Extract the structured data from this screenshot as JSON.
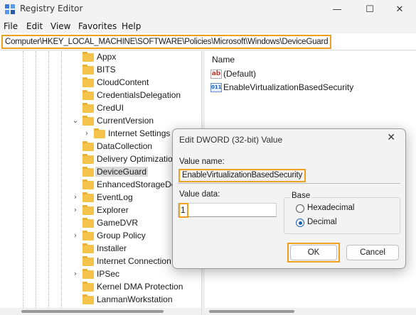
{
  "window": {
    "title": "Registry Editor",
    "min": "—",
    "max": "☐",
    "close": "✕"
  },
  "menu": [
    "File",
    "Edit",
    "View",
    "Favorites",
    "Help"
  ],
  "address": "Computer\\HKEY_LOCAL_MACHINE\\SOFTWARE\\Policies\\Microsoft\\Windows\\DeviceGuard",
  "tree": [
    {
      "label": "Appx",
      "expander": ""
    },
    {
      "label": "BITS",
      "expander": ""
    },
    {
      "label": "CloudContent",
      "expander": ""
    },
    {
      "label": "CredentialsDelegation",
      "expander": ""
    },
    {
      "label": "CredUI",
      "expander": ""
    },
    {
      "label": "CurrentVersion",
      "expander": "⌄"
    },
    {
      "label": "Internet Settings",
      "expander": "›"
    },
    {
      "label": "DataCollection",
      "expander": ""
    },
    {
      "label": "Delivery Optimization",
      "expander": ""
    },
    {
      "label": "DeviceGuard",
      "expander": "",
      "selected": true
    },
    {
      "label": "EnhancedStorageDevices",
      "expander": ""
    },
    {
      "label": "EventLog",
      "expander": "›"
    },
    {
      "label": "Explorer",
      "expander": "›"
    },
    {
      "label": "GameDVR",
      "expander": ""
    },
    {
      "label": "Group Policy",
      "expander": "›"
    },
    {
      "label": "Installer",
      "expander": ""
    },
    {
      "label": "Internet Connection",
      "expander": ""
    },
    {
      "label": "IPSec",
      "expander": "›"
    },
    {
      "label": "Kernel DMA Protection",
      "expander": ""
    },
    {
      "label": "LanmanWorkstation",
      "expander": ""
    }
  ],
  "list": {
    "header": "Name",
    "rows": [
      {
        "label": "(Default)",
        "icon": "ab"
      },
      {
        "label": "EnableVirtualizationBasedSecurity",
        "icon": "011"
      }
    ]
  },
  "dialog": {
    "title": "Edit DWORD (32-bit) Value",
    "close": "✕",
    "value_name_label": "Value name:",
    "value_name": "EnableVirtualizationBasedSecurity",
    "value_data_label": "Value data:",
    "value_data": "1",
    "base_label": "Base",
    "hex_label": "Hexadecimal",
    "dec_label": "Decimal",
    "ok_label": "OK",
    "cancel_label": "Cancel"
  }
}
